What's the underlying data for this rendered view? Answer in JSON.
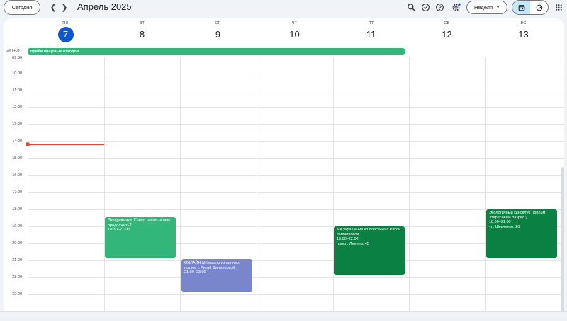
{
  "toolbar": {
    "today_label": "Сегодня",
    "month_title": "Апрель 2025",
    "view_label": "Неделя"
  },
  "timezone_label": "GMT+03",
  "days": [
    {
      "dow": "ПН",
      "num": "7",
      "today": true
    },
    {
      "dow": "ВТ",
      "num": "8"
    },
    {
      "dow": "СР",
      "num": "9"
    },
    {
      "dow": "ЧТ",
      "num": "10"
    },
    {
      "dow": "ПТ",
      "num": "11"
    },
    {
      "dow": "СБ",
      "num": "12"
    },
    {
      "dow": "ВС",
      "num": "13"
    }
  ],
  "hours": [
    "09:00",
    "10:00",
    "11:00",
    "12:00",
    "13:00",
    "14:00",
    "15:00",
    "16:00",
    "17:00",
    "18:00",
    "19:00",
    "20:00",
    "21:00",
    "22:00",
    "23:00"
  ],
  "allday_event": {
    "title": "приём пищевых отходов",
    "color": "#33b679"
  },
  "events": [
    {
      "title": "Экопривычки. С чего начать и чем продолжить?",
      "time": "18:30–21:00",
      "place": "",
      "color": "#33b679"
    },
    {
      "title": "ОНЛАЙН МК кашпо из винных лотков с Ритой Филипповой",
      "time": "21:00–23:00",
      "place": "",
      "color": "#7986cb"
    },
    {
      "title": "МК украшения из пластика с Ритой Филипповой",
      "time": "19:00–22:00",
      "place": "просп. Ленина, 45",
      "color": "#0b8043"
    },
    {
      "title": "Экологичный киноклуб (фильм \"Вересовый разряд\")",
      "time": "18:00–21:00",
      "place": "ул. Шевченко, 20",
      "color": "#0b8043"
    }
  ],
  "colors": {
    "accent": "#0b57d0",
    "now_line": "#ea4335"
  },
  "icons": [
    "search-icon",
    "offline-check-icon",
    "help-icon",
    "settings-icon",
    "apps-grid-icon",
    "calendar-view-icon",
    "tasks-view-icon"
  ]
}
